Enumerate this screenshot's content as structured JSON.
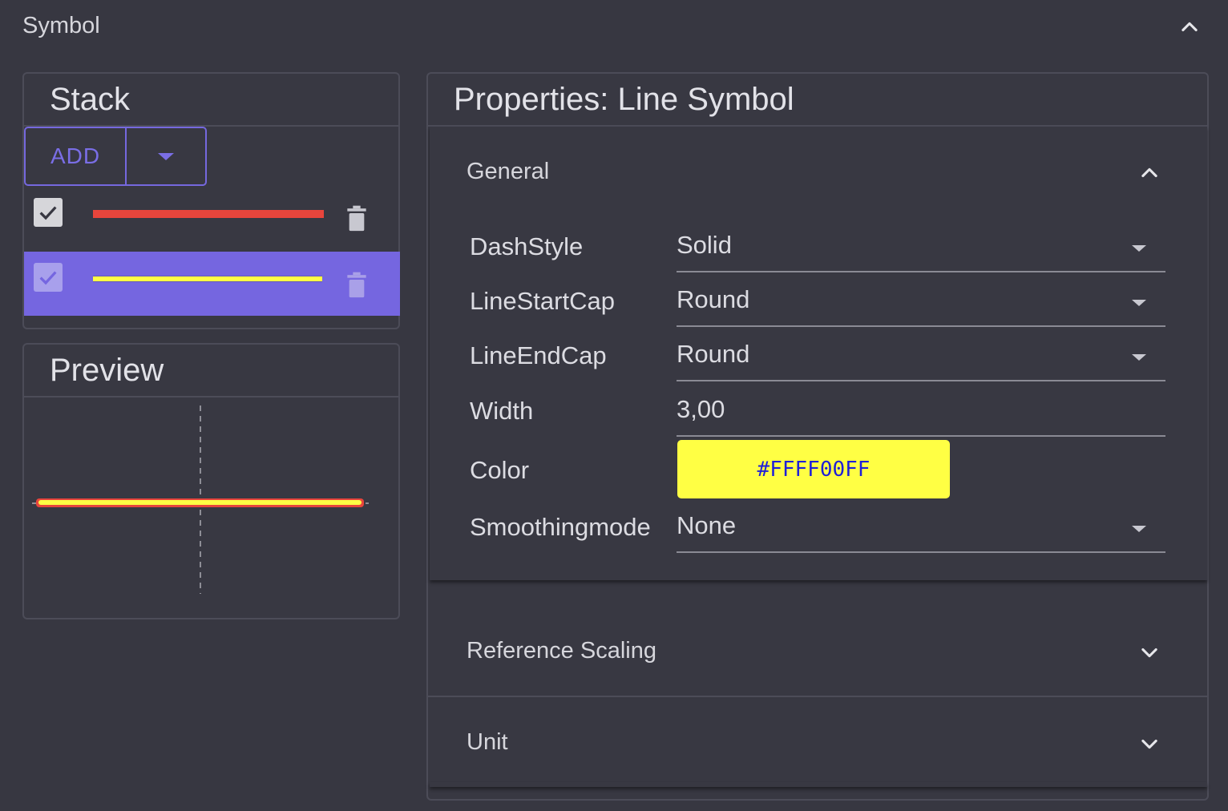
{
  "section": {
    "title": "Symbol",
    "collapse_icon": "chevron-up-icon"
  },
  "stack": {
    "title": "Stack",
    "add_label": "ADD",
    "layers": [
      {
        "color": "#e8453c",
        "checked": true,
        "selected": false
      },
      {
        "color": "#ffff44",
        "checked": true,
        "selected": true
      }
    ]
  },
  "preview": {
    "title": "Preview",
    "line_color": "#ffff44",
    "outline_color": "#e8453c"
  },
  "properties": {
    "title": "Properties: Line Symbol",
    "general": {
      "title": "General",
      "expanded": true,
      "fields": {
        "dashstyle": {
          "label": "DashStyle",
          "value": "Solid"
        },
        "linestartcap": {
          "label": "LineStartCap",
          "value": "Round"
        },
        "lineendcap": {
          "label": "LineEndCap",
          "value": "Round"
        },
        "width": {
          "label": "Width",
          "value": "3,00"
        },
        "color": {
          "label": "Color",
          "value": "#FFFF00FF"
        },
        "smoothingmode": {
          "label": "Smoothingmode",
          "value": "None"
        }
      }
    },
    "reference_scaling": {
      "title": "Reference Scaling",
      "expanded": false
    },
    "unit": {
      "title": "Unit",
      "expanded": false
    }
  },
  "colors": {
    "background": "#373741",
    "accent": "#7566e0",
    "swatch": "#ffff44",
    "swatch_text": "#1f1fd8"
  }
}
